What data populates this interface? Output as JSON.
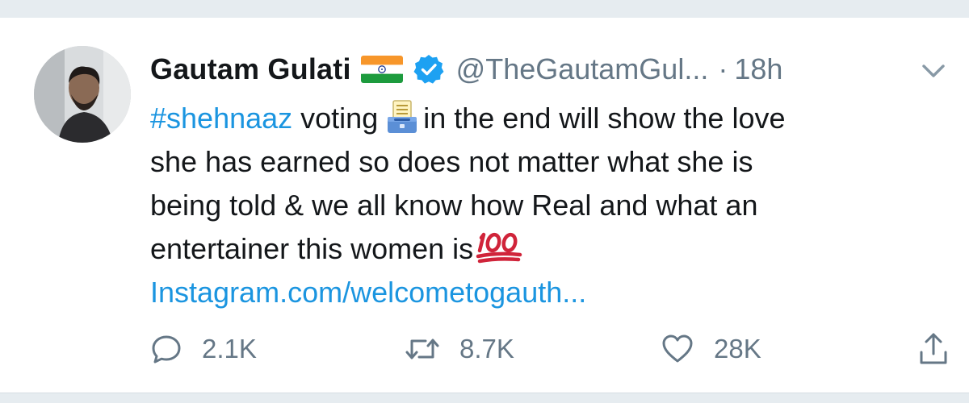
{
  "tweet": {
    "author": {
      "display_name": "Gautam Gulati",
      "handle": "@TheGautamGul...",
      "verified": true,
      "flag_icon": "india-flag-icon"
    },
    "separator": "·",
    "timestamp": "18h",
    "body": {
      "hashtag": "#shehnaaz",
      "line1_after_hashtag": " voting",
      "line1_after_emoji": "in the end will show the love",
      "line2": "she has earned so does not matter what she is",
      "line3": "being told & we all know how Real and what an",
      "line4": "entertainer this women is",
      "emoji_ballot": "ballot-box-icon",
      "emoji_hundred": "hundred-points-icon",
      "link": "Instagram.com/welcometogauth..."
    },
    "stats": {
      "replies": "2.1K",
      "retweets": "8.7K",
      "likes": "28K"
    }
  },
  "colors": {
    "link": "#1b95e0",
    "secondary_text": "#657786",
    "verified": "#1da1f2",
    "background_strip": "#e6ecf0"
  }
}
